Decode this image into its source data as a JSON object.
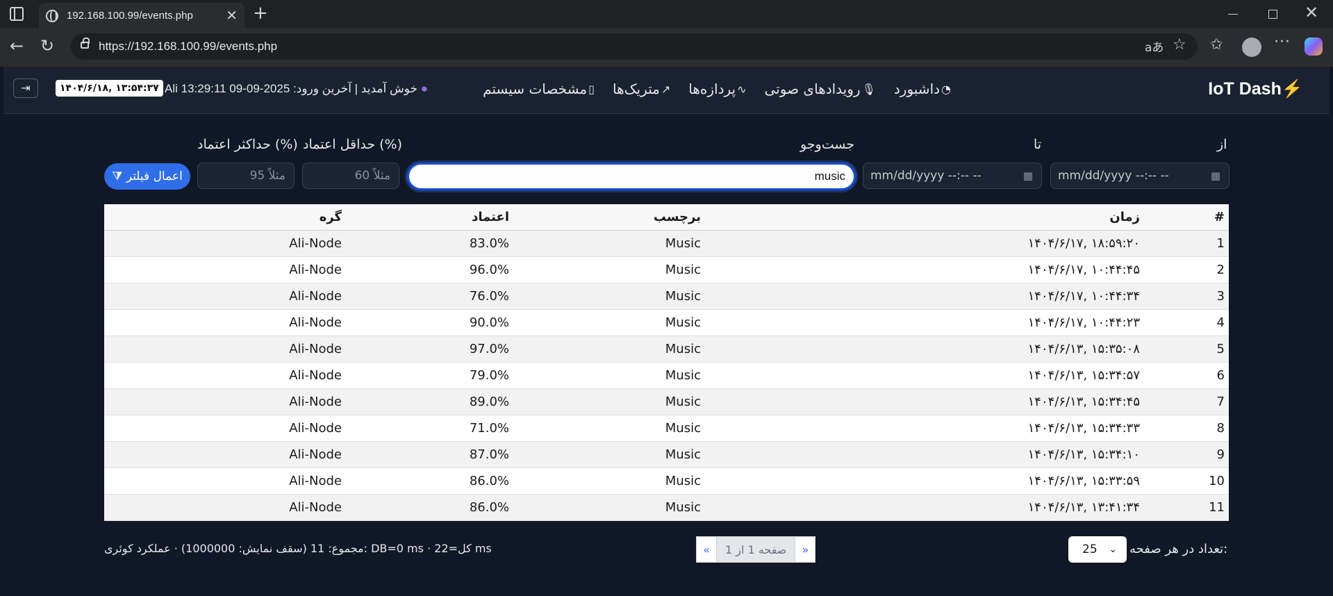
{
  "browser": {
    "tab_title": "192.168.100.99/events.php",
    "url": "https://192.168.100.99/events.php",
    "read_aloud_glyph": "aあ"
  },
  "app": {
    "brand": "IoT Dash",
    "brand_bolt": "⚡",
    "nav": [
      {
        "label": "داشبورد",
        "icon": "dashboard-icon"
      },
      {
        "label": "رویدادهای صوتی",
        "icon": "mic-icon"
      },
      {
        "label": "پردازه‌ها",
        "icon": "activity-icon"
      },
      {
        "label": "متریک‌ها",
        "icon": "chart-line-icon"
      },
      {
        "label": "مشخصات سیستم",
        "icon": "device-icon"
      }
    ],
    "welcome": "Ali خوش آمدید | آخرین ورود: 2025-09-09 13:29:11",
    "clock": "۱۴۰۴/۶/۱۸, ۱۳:۵۴:۳۷"
  },
  "filters": {
    "from_label": "از",
    "to_label": "تا",
    "search_label": "جست‌وجو",
    "min_conf_label": "حداقل اعتماد (%)",
    "max_conf_label": "حداکثر اعتماد (%)",
    "from_placeholder": "mm/dd/yyyy --:-- --",
    "to_placeholder": "mm/dd/yyyy --:-- --",
    "search_value": "music",
    "min_placeholder": "مثلاً 60",
    "max_placeholder": "مثلاً 95",
    "apply_label": "اعمال فیلتر"
  },
  "table": {
    "headers": {
      "idx": "#",
      "time": "زمان",
      "label": "برچسب",
      "conf": "اعتماد",
      "node": "گره"
    },
    "rows": [
      {
        "idx": "1",
        "time": "۱۴۰۴/۶/۱۷, ۱۸:۵۹:۲۰",
        "label": "Music",
        "conf": "83.0%",
        "node": "Ali-Node"
      },
      {
        "idx": "2",
        "time": "۱۴۰۴/۶/۱۷, ۱۰:۴۴:۴۵",
        "label": "Music",
        "conf": "96.0%",
        "node": "Ali-Node"
      },
      {
        "idx": "3",
        "time": "۱۴۰۴/۶/۱۷, ۱۰:۴۴:۳۴",
        "label": "Music",
        "conf": "76.0%",
        "node": "Ali-Node"
      },
      {
        "idx": "4",
        "time": "۱۴۰۴/۶/۱۷, ۱۰:۴۴:۲۳",
        "label": "Music",
        "conf": "90.0%",
        "node": "Ali-Node"
      },
      {
        "idx": "5",
        "time": "۱۴۰۴/۶/۱۳, ۱۵:۳۵:۰۸",
        "label": "Music",
        "conf": "97.0%",
        "node": "Ali-Node"
      },
      {
        "idx": "6",
        "time": "۱۴۰۴/۶/۱۳, ۱۵:۳۴:۵۷",
        "label": "Music",
        "conf": "79.0%",
        "node": "Ali-Node"
      },
      {
        "idx": "7",
        "time": "۱۴۰۴/۶/۱۳, ۱۵:۳۴:۴۵",
        "label": "Music",
        "conf": "89.0%",
        "node": "Ali-Node"
      },
      {
        "idx": "8",
        "time": "۱۴۰۴/۶/۱۳, ۱۵:۳۴:۳۳",
        "label": "Music",
        "conf": "71.0%",
        "node": "Ali-Node"
      },
      {
        "idx": "9",
        "time": "۱۴۰۴/۶/۱۳, ۱۵:۳۴:۱۰",
        "label": "Music",
        "conf": "87.0%",
        "node": "Ali-Node"
      },
      {
        "idx": "10",
        "time": "۱۴۰۴/۶/۱۳, ۱۵:۳۳:۵۹",
        "label": "Music",
        "conf": "86.0%",
        "node": "Ali-Node"
      },
      {
        "idx": "11",
        "time": "۱۴۰۴/۶/۱۳, ۱۳:۴۱:۳۴",
        "label": "Music",
        "conf": "86.0%",
        "node": "Ali-Node"
      }
    ]
  },
  "footer": {
    "per_page_label": "تعداد در هر صفحه:",
    "per_page_value": "25",
    "page_info": "صفحه 1 از 1",
    "prev": "«",
    "next": "»",
    "stats": "مجموع: 11 (سقف نمایش: 1000000) · عملکرد کوئری: DB=0 ms · کل=22 ms"
  }
}
